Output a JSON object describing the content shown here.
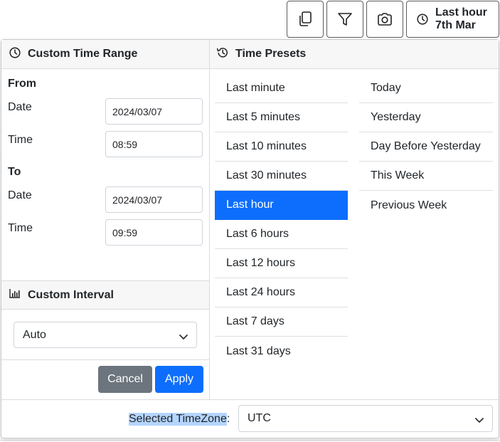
{
  "toolbar": {
    "buttons": [
      {
        "icon": "copy-icon"
      },
      {
        "icon": "filter-icon"
      },
      {
        "icon": "camera-icon"
      }
    ],
    "time_button": {
      "icon": "clock-icon",
      "line1": "Last hour",
      "line2": "7th Mar"
    }
  },
  "custom_time_range": {
    "title": "Custom Time Range",
    "from": {
      "heading": "From",
      "date_label": "Date",
      "date_value": "2024/03/07",
      "time_label": "Time",
      "time_value": "08:59"
    },
    "to": {
      "heading": "To",
      "date_label": "Date",
      "date_value": "2024/03/07",
      "time_label": "Time",
      "time_value": "09:59"
    }
  },
  "custom_interval": {
    "title": "Custom Interval",
    "selected": "Auto"
  },
  "actions": {
    "cancel": "Cancel",
    "apply": "Apply"
  },
  "time_presets": {
    "title": "Time Presets",
    "column1": [
      "Last minute",
      "Last 5 minutes",
      "Last 10 minutes",
      "Last 30 minutes",
      "Last hour",
      "Last 6 hours",
      "Last 12 hours",
      "Last 24 hours",
      "Last 7 days",
      "Last 31 days"
    ],
    "column2": [
      "Today",
      "Yesterday",
      "Day Before Yesterday",
      "This Week",
      "Previous Week"
    ],
    "active": "Last hour"
  },
  "timezone": {
    "label": "Selected TimeZone",
    "colon": ":",
    "selected": "UTC"
  },
  "colors": {
    "accent": "#0d6efd",
    "cancel": "#6c757d",
    "selection": "#b4d5fe"
  }
}
